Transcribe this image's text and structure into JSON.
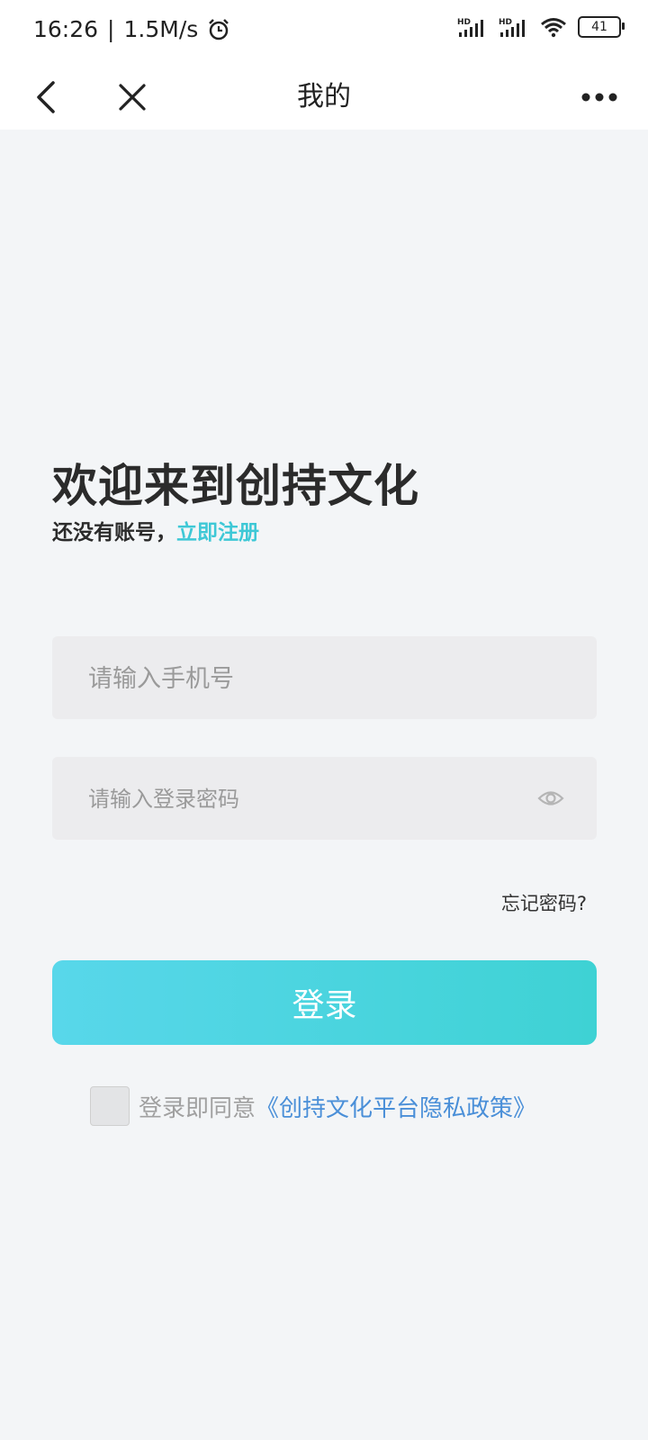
{
  "status_bar": {
    "time": "16:26",
    "separator": "|",
    "speed": "1.5M/s",
    "signal_label_1": "HD",
    "signal_label_2": "HD",
    "battery": "41"
  },
  "nav": {
    "title": "我的"
  },
  "welcome": {
    "title": "欢迎来到创持文化",
    "no_account": "还没有账号，",
    "register_link": "立即注册"
  },
  "form": {
    "phone_placeholder": "请输入手机号",
    "password_placeholder": "请输入登录密码",
    "forgot": "忘记密码?",
    "login_button": "登录"
  },
  "agreement": {
    "prefix": "登录即同意",
    "policy_link": "《创持文化平台隐私政策》"
  },
  "colors": {
    "accent": "#3ec8d6",
    "link_blue": "#4a8fd8",
    "background": "#f3f5f7"
  }
}
